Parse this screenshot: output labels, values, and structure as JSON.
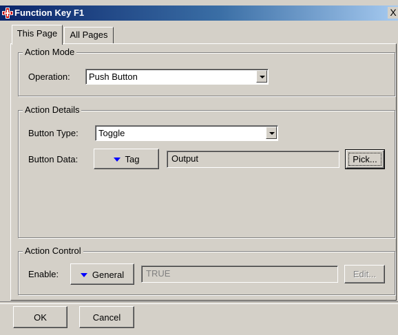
{
  "window": {
    "title": "Function Key F1",
    "close_label": "X"
  },
  "tabs": [
    {
      "label": "This Page"
    },
    {
      "label": "All Pages"
    }
  ],
  "action_mode": {
    "legend": "Action Mode",
    "operation_label": "Operation:",
    "operation_value": "Push Button"
  },
  "action_details": {
    "legend": "Action Details",
    "button_type_label": "Button Type:",
    "button_type_value": "Toggle",
    "button_data_label": "Button Data:",
    "button_data_source": "Tag",
    "button_data_value": "Output",
    "pick_label": "Pick..."
  },
  "action_control": {
    "legend": "Action Control",
    "enable_label": "Enable:",
    "enable_source": "General",
    "enable_value": "TRUE",
    "edit_label": "Edit..."
  },
  "footer": {
    "ok_label": "OK",
    "cancel_label": "Cancel"
  },
  "colors": {
    "dialog_bg": "#d4d0c8",
    "title_start": "#0a246a",
    "title_end": "#a6caf0",
    "source_arrow": "#0000ff"
  },
  "icons": {
    "app": "function-key-cross-icon",
    "dropdown": "chevron-down-icon",
    "source": "triangle-down-icon"
  }
}
